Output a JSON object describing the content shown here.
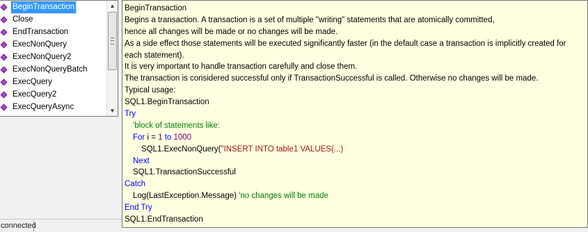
{
  "autocomplete": {
    "selected_index": 0,
    "items": [
      {
        "label": "BeginTransaction",
        "icon": "method-icon"
      },
      {
        "label": "Close",
        "icon": "method-icon"
      },
      {
        "label": "EndTransaction",
        "icon": "method-icon"
      },
      {
        "label": "ExecNonQuery",
        "icon": "method-icon"
      },
      {
        "label": "ExecNonQuery2",
        "icon": "method-icon"
      },
      {
        "label": "ExecNonQueryBatch",
        "icon": "method-icon"
      },
      {
        "label": "ExecQuery",
        "icon": "method-icon"
      },
      {
        "label": "ExecQuery2",
        "icon": "method-icon"
      },
      {
        "label": "ExecQueryAsync",
        "icon": "method-icon"
      }
    ],
    "scroll_position": 0.0
  },
  "tooltip": {
    "title": "BeginTransaction",
    "desc1": "Begins a transaction. A transaction is a set of multiple \"writing\" statements that are atomically committed,",
    "desc2": "hence all changes will be made or no changes will be made.",
    "desc3": "As a side effect those statements will be executed significantly faster (in the default case a transaction is implicitly created for",
    "desc4": "each statement).",
    "desc5": "It is very important to handle transaction carefully and close them.",
    "desc6": "The transaction is considered successful only if TransactionSuccessful is called. Otherwise no changes will be made.",
    "usage": "Typical usage:",
    "code": {
      "line1": "SQL1.BeginTransaction",
      "try_kw": "Try",
      "comment1": "'block of statements like:",
      "for_kw": "For",
      "for_var": " i = ",
      "for_start": "1",
      "to_kw": " to ",
      "for_end": "1000",
      "exec_call": "SQL1.ExecNonQuery(",
      "exec_string": "\"INSERT INTO table1 VALUES(...)",
      "next_kw": "Next",
      "success_call": "SQL1.TransactionSuccessful",
      "catch_kw": "Catch",
      "log_call": "Log(LastException.Message) ",
      "comment2": "'no changes will be made",
      "endtry_kw": "End Try",
      "end_call": "SQL1.EndTransaction"
    }
  },
  "statusbar": {
    "text": "connected"
  },
  "colors": {
    "keyword": "#0000ff",
    "number": "#800080",
    "string": "#a31515",
    "comment": "#008000",
    "tooltip_bg": "#ffffe1",
    "selection": "#3399ff"
  }
}
